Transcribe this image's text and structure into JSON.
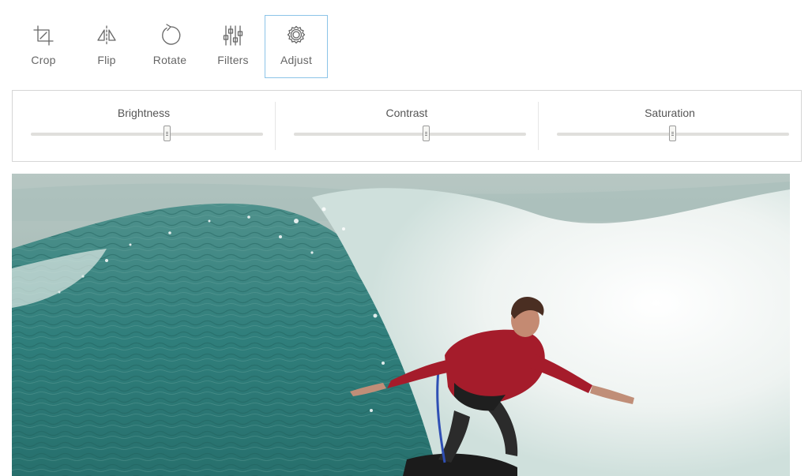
{
  "toolbar": {
    "tools": [
      {
        "label": "Crop",
        "icon": "crop-icon"
      },
      {
        "label": "Flip",
        "icon": "flip-icon"
      },
      {
        "label": "Rotate",
        "icon": "rotate-icon"
      },
      {
        "label": "Filters",
        "icon": "filters-icon"
      },
      {
        "label": "Adjust",
        "icon": "gear-icon"
      }
    ],
    "active_tool": "Adjust"
  },
  "adjust": {
    "brightness": {
      "label": "Brightness",
      "level": 0.59
    },
    "contrast": {
      "label": "Contrast",
      "level": 0.57
    },
    "saturation": {
      "label": "Saturation",
      "level": 0.5
    }
  },
  "photo": {
    "subject": "surfer-on-wave",
    "colors": {
      "sea": "#2f7e7b",
      "foam": "#e9efed",
      "wetsuit": "#a51c2b"
    }
  }
}
